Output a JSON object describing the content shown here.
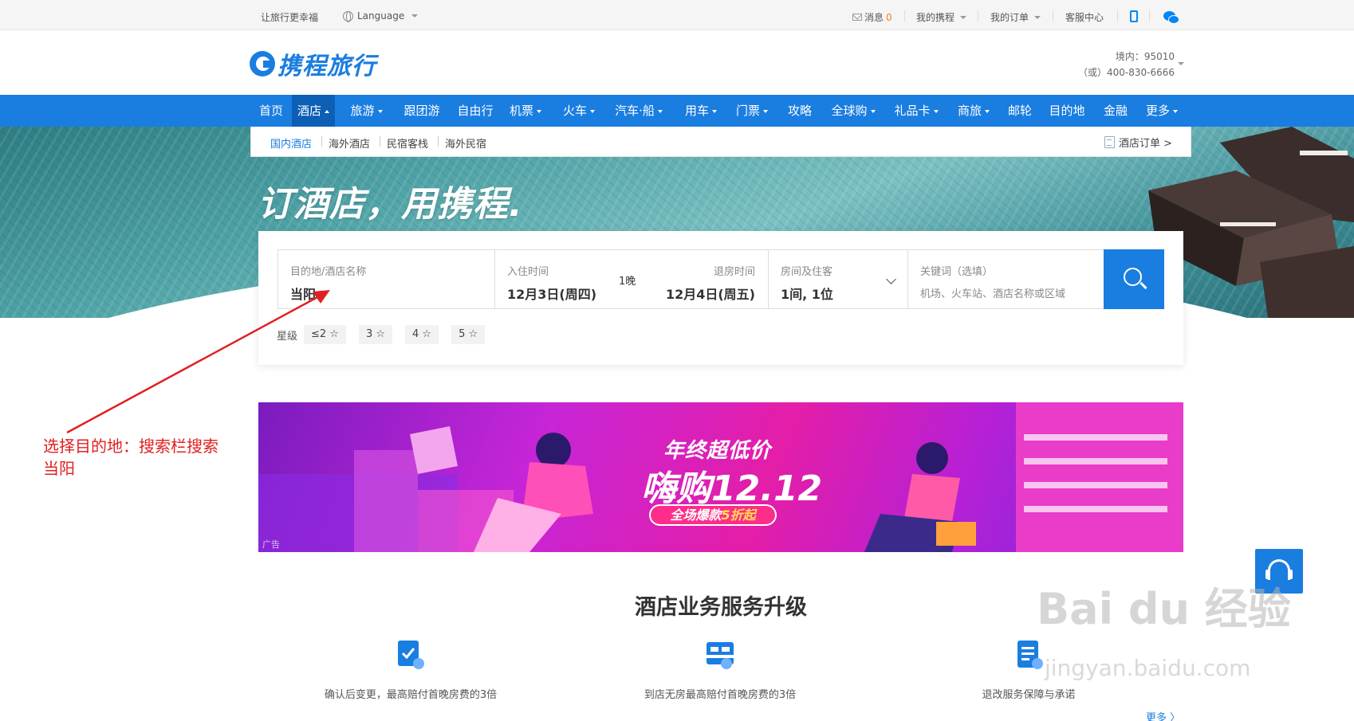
{
  "topbar": {
    "slogan": "让旅行更幸福",
    "language": "Language",
    "messages_label": "消息",
    "messages_count": "0",
    "my_ctrip": "我的携程",
    "my_orders": "我的订单",
    "service": "客服中心"
  },
  "header": {
    "logo_text": "携程旅行",
    "hotline_domestic": "境内：95010",
    "hotline_alt": "（或）400-830-6666"
  },
  "nav": {
    "items": [
      {
        "label": "首页",
        "dropdown": false
      },
      {
        "label": "酒店",
        "dropdown": true,
        "active": true
      },
      {
        "label": "旅游",
        "dropdown": true
      },
      {
        "label": "跟团游",
        "dropdown": false
      },
      {
        "label": "自由行",
        "dropdown": false
      },
      {
        "label": "机票",
        "dropdown": true
      },
      {
        "label": "火车",
        "dropdown": true
      },
      {
        "label": "汽车·船",
        "dropdown": true
      },
      {
        "label": "用车",
        "dropdown": true
      },
      {
        "label": "门票",
        "dropdown": true
      },
      {
        "label": "攻略",
        "dropdown": false
      },
      {
        "label": "全球购",
        "dropdown": true
      },
      {
        "label": "礼品卡",
        "dropdown": true
      },
      {
        "label": "商旅",
        "dropdown": true
      },
      {
        "label": "邮轮",
        "dropdown": false
      },
      {
        "label": "目的地",
        "dropdown": false
      },
      {
        "label": "金融",
        "dropdown": false
      },
      {
        "label": "更多",
        "dropdown": true
      }
    ]
  },
  "subnav": {
    "items": [
      "国内酒店",
      "海外酒店",
      "民宿客栈",
      "海外民宿"
    ],
    "orders_label": "酒店订单 >"
  },
  "hero": {
    "slogan": "订酒店，用携程."
  },
  "search": {
    "destination_label": "目的地/酒店名称",
    "destination_value": "当阳",
    "checkin_label": "入住时间",
    "checkin_value": "12月3日(周四)",
    "nights": "1晚",
    "checkout_label": "退房时间",
    "checkout_value": "12月4日(周五)",
    "rooms_label": "房间及住客",
    "rooms_value": "1间, 1位",
    "keyword_label": "关键词（选填）",
    "keyword_placeholder": "机场、火车站、酒店名称或区域",
    "star_label": "星级",
    "star_options": [
      "≤2 ☆",
      "3 ☆",
      "4 ☆",
      "5 ☆"
    ]
  },
  "banner": {
    "title1": "年终超低价",
    "title2": "嗨购12.12",
    "pill_prefix": "全场爆款",
    "pill_highlight": "5折起",
    "ad_tag": "广告"
  },
  "services": {
    "title": "酒店业务服务升级",
    "features": [
      "确认后变更，最高赔付首晚房费的3倍",
      "到店无房最高赔付首晚房费的3倍",
      "退改服务保障与承诺"
    ],
    "more": "更多 〉"
  },
  "annotation": {
    "line1": "选择目的地：搜索栏搜索",
    "line2": "当阳"
  },
  "watermark": {
    "main": "Bai  du 经验",
    "sub": "jingyan.baidu.com"
  },
  "colors": {
    "brand_blue": "#1a7de0",
    "annotation_red": "#e02020",
    "message_count": "#ff7d13"
  }
}
